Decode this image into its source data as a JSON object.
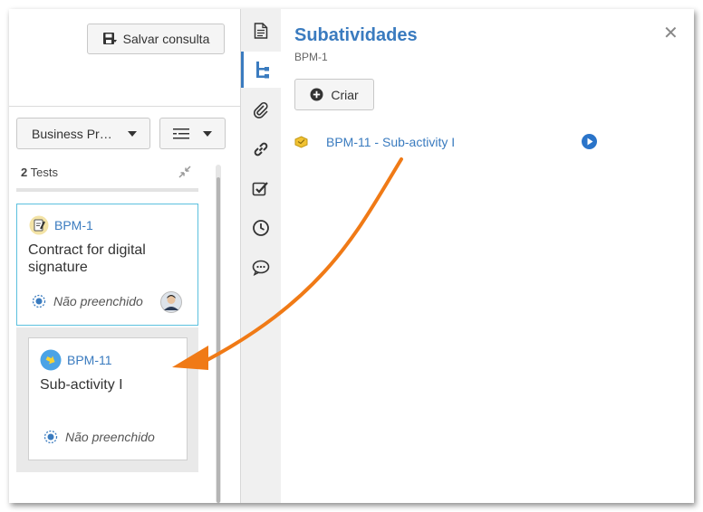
{
  "toolbar": {
    "save_label": "Salvar consulta"
  },
  "filters": {
    "process_dropdown": "Business Pr…"
  },
  "list": {
    "count": "2",
    "count_label": " Tests"
  },
  "cards": [
    {
      "id": "BPM-1",
      "title": "Contract for digital signature",
      "status": "Não preenchido"
    },
    {
      "id": "BPM-11",
      "title": "Sub-activity I",
      "status": "Não preenchido"
    }
  ],
  "panel": {
    "title": "Subatividades",
    "subtitle": "BPM-1",
    "create_label": "Criar",
    "subactivities": [
      {
        "label": "BPM-11 - Sub-activity I"
      }
    ]
  },
  "tabs": [
    "document-icon",
    "hierarchy-icon",
    "attachment-icon",
    "link-icon",
    "checklist-icon",
    "clock-icon",
    "comment-icon"
  ],
  "colors": {
    "accent": "#3a7bbf",
    "arrow": "#f07a16",
    "card_border": "#5bc0de"
  }
}
